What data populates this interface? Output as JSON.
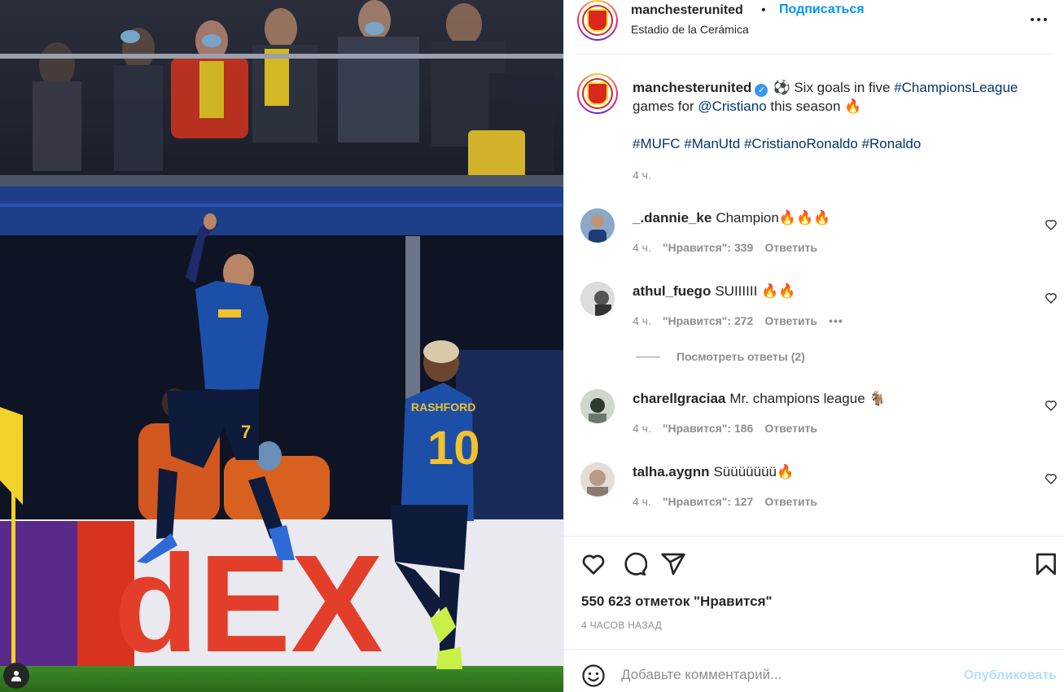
{
  "post": {
    "username": "manchesterunited",
    "dot": "•",
    "follow_label": "Подписаться",
    "location": "Estadio de la Cerámica",
    "more_icon": "more-horizontal-icon"
  },
  "caption": {
    "username": "manchesterunited",
    "verified_glyph": "✓",
    "ball": "⚽",
    "text_1": "Six goals in five",
    "hashtag_cl": "#ChampionsLeague",
    "text_2": "games for",
    "mention": "@Cristiano",
    "text_3": "this season 🔥",
    "hashtags": "#MUFC #ManUtd #CristianoRonaldo #Ronaldo",
    "time": "4 ч."
  },
  "comments": [
    {
      "username": "_.dannie_ke",
      "text": "Champion🔥🔥🔥",
      "time": "4 ч.",
      "likes": "\"Нравится\": 339",
      "reply": "Ответить"
    },
    {
      "username": "athul_fuego",
      "text": "SUIIIIII 🔥🔥",
      "time": "4 ч.",
      "likes": "\"Нравится\": 272",
      "reply": "Ответить",
      "more": "•••"
    },
    {
      "username": "charellgraciaa",
      "text": "Mr. champions league 🐐",
      "time": "4 ч.",
      "likes": "\"Нравится\": 186",
      "reply": "Ответить"
    },
    {
      "username": "talha.aygnn",
      "text": "Süüüüüüü🔥",
      "time": "4 ч.",
      "likes": "\"Нравится\": 127",
      "reply": "Ответить"
    }
  ],
  "view_replies": "Посмотреть ответы (2)",
  "actions": {
    "likes_count": "550 623 отметок \"Нравится\"",
    "time_ago": "4 ЧАСОВ НАЗАД"
  },
  "add_comment": {
    "placeholder": "Добавьте комментарий...",
    "publish_label": "Опубликовать"
  },
  "photo": {
    "player_10_name": "RASHFORD",
    "player_10_number": "10",
    "player_7_number": "7",
    "board_text": "dEX"
  },
  "colors": {
    "accent": "#0095f6",
    "publish_disabled": "#b2dffc",
    "muted": "#8e8e8e",
    "text": "#262626",
    "kit_blue": "#1c4fa8"
  }
}
